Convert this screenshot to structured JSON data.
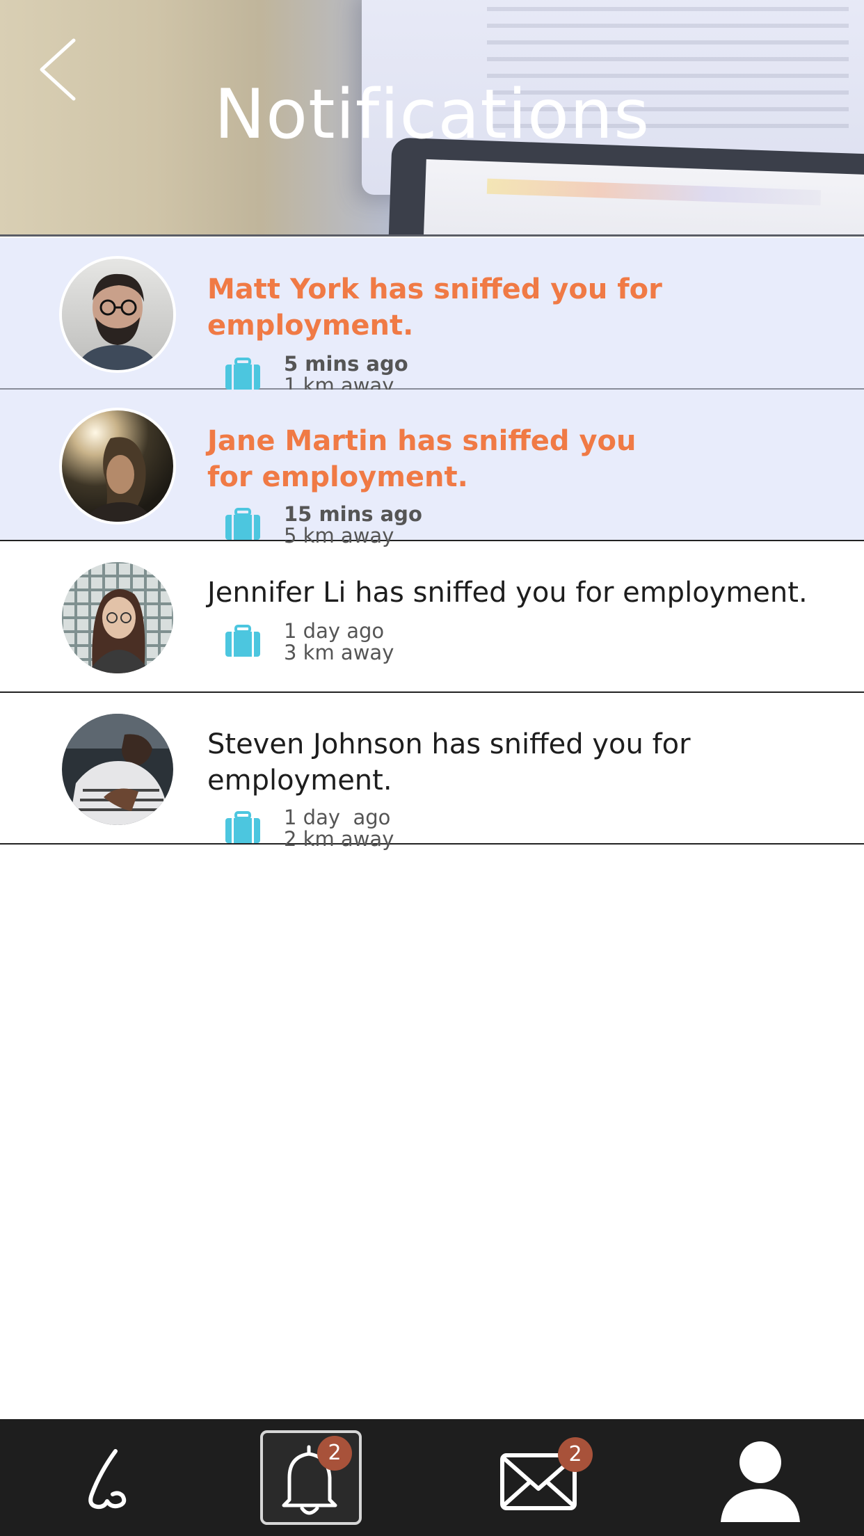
{
  "header": {
    "title": "Notifications",
    "back_icon": "chevron-left-icon"
  },
  "notifications": [
    {
      "message": "Matt York has sniffed you for employment.",
      "time": "5 mins ago",
      "distance": "1 km away",
      "unread": true,
      "icon": "briefcase-icon"
    },
    {
      "message": "Jane Martin has sniffed you for employment.",
      "time": "15 mins ago",
      "distance": "5 km away",
      "unread": true,
      "icon": "briefcase-icon"
    },
    {
      "message": "Jennifer Li has sniffed you for employment.",
      "time": "1 day ago",
      "distance": "3 km away",
      "unread": false,
      "icon": "briefcase-icon"
    },
    {
      "message": "Steven Johnson has sniffed you for employment.",
      "time": "1 day  ago",
      "distance": "2 km away",
      "unread": false,
      "icon": "briefcase-icon"
    }
  ],
  "bottom_nav": {
    "items": [
      {
        "icon": "nose-icon",
        "badge": null,
        "active": false
      },
      {
        "icon": "bell-icon",
        "badge": "2",
        "active": true
      },
      {
        "icon": "envelope-icon",
        "badge": "2",
        "active": false
      },
      {
        "icon": "user-icon",
        "badge": null,
        "active": false
      }
    ]
  },
  "colors": {
    "unread_text": "#f07a45",
    "unread_background": "#e8ecfb",
    "briefcase": "#4cc6df",
    "nav_background": "#1e1e1e",
    "badge": "#a8523a"
  }
}
